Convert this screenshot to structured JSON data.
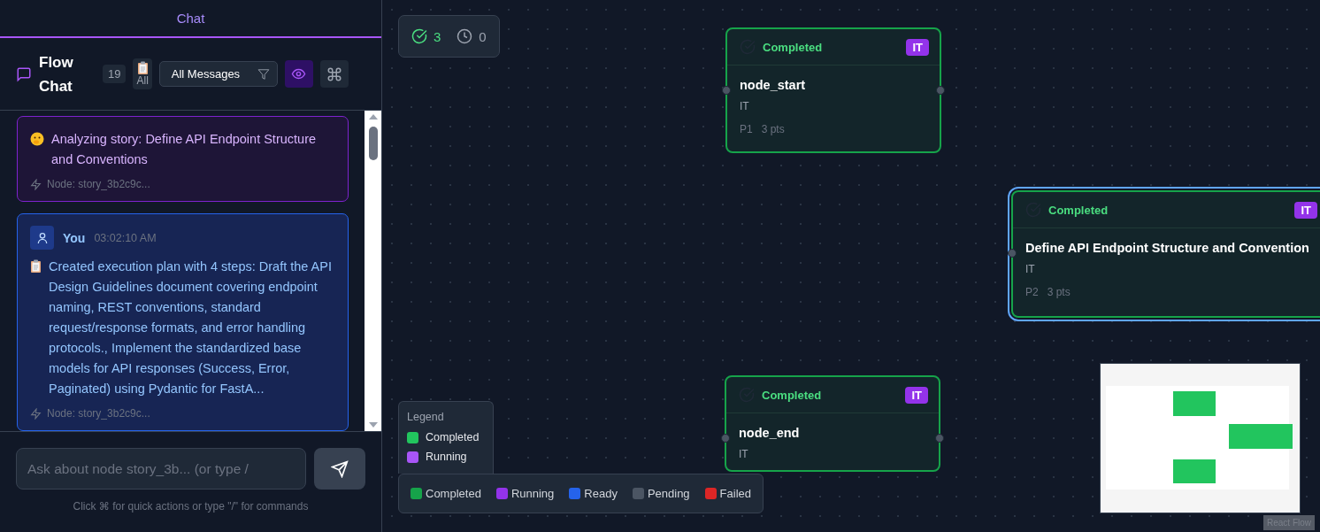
{
  "chat_tab": {
    "label": "Chat",
    "selected": true
  },
  "header": {
    "title": "Flow Chat",
    "count": "19",
    "all_button": "All",
    "filter": "All Messages",
    "eye_active": true
  },
  "messages": [
    {
      "kind": "agent",
      "text": "Analyzing story: Define API Endpoint Structure and Conventions",
      "node": "Node: story_3b2c9c..."
    },
    {
      "kind": "user",
      "sender": "You",
      "time": "03:02:10 AM",
      "text": "Created execution plan with 4 steps: Draft the API Design Guidelines document covering endpoint naming, REST conventions, standard request/response formats, and error handling protocols., Implement the standardized base models for API responses (Success, Error, Paginated) using Pydantic for FastA...",
      "node": "Node: story_3b2c9c..."
    }
  ],
  "input": {
    "placeholder": "Ask about node story_3b... (or type /"
  },
  "hint": "Click ⌘ for quick actions or type \"/\" for commands",
  "stats": {
    "completed": "3",
    "pending": "0"
  },
  "nodes": [
    {
      "status": "Completed",
      "tag": "IT",
      "title": "node_start",
      "subtitle": "IT",
      "priority": "P1",
      "points": "3 pts",
      "selected": false
    },
    {
      "status": "Completed",
      "tag": "IT",
      "title": "Define API Endpoint Structure and Convention",
      "subtitle": "IT",
      "priority": "P2",
      "points": "3 pts",
      "selected": true
    },
    {
      "status": "Completed",
      "tag": "IT",
      "title": "node_end",
      "subtitle": "IT",
      "selected": false
    }
  ],
  "legend": {
    "title": "Legend",
    "items": [
      {
        "label": "Completed",
        "color": "#22c55e"
      },
      {
        "label": "Running",
        "color": "#a855f7"
      }
    ]
  },
  "status_bar": [
    {
      "label": "Completed",
      "color": "#16a34a"
    },
    {
      "label": "Running",
      "color": "#9333ea"
    },
    {
      "label": "Ready",
      "color": "#2563eb"
    },
    {
      "label": "Pending",
      "color": "#4b5563"
    },
    {
      "label": "Failed",
      "color": "#dc2626"
    }
  ],
  "attribution": "React Flow"
}
